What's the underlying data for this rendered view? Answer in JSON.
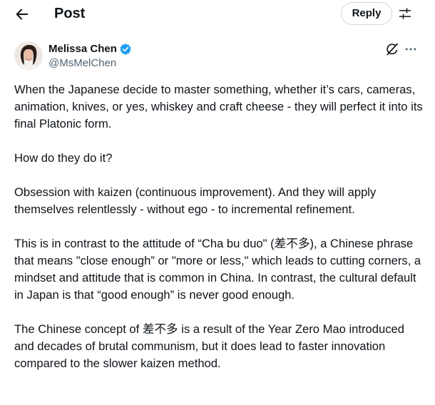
{
  "header": {
    "title": "Post",
    "reply_label": "Reply"
  },
  "author": {
    "display_name": "Melissa Chen",
    "handle": "@MsMelChen"
  },
  "tweet": {
    "paragraphs": [
      "When the Japanese decide to master something, whether it’s cars, cameras, animation, knives, or yes, whiskey and craft cheese - they will perfect it into its final Platonic form.",
      "How do they do it?",
      "Obsession with kaizen (continuous improvement). And they will apply themselves relentlessly - without ego - to incremental refinement.",
      "This is in contrast to the attitude of “Cha bu duo\" (差不多), a Chinese phrase that means \"close enough” or \"more or less,\" which leads to cutting corners, a mindset and attitude that is common in China. In contrast, the cultural default in Japan is that “good enough” is never good enough.",
      "The Chinese concept of 差不多 is a result of the Year Zero Mao introduced and decades of brutal communism, but it does lead to faster innovation compared to the slower kaizen method."
    ]
  },
  "icons": {
    "back": "arrow-left-icon",
    "settings": "sliders-icon",
    "verified": "verified-badge-icon",
    "grok": "grok-icon",
    "more": "more-icon"
  },
  "colors": {
    "verified_blue": "#1d9bf0",
    "secondary_text": "#536471",
    "primary_text": "#0f1419"
  }
}
